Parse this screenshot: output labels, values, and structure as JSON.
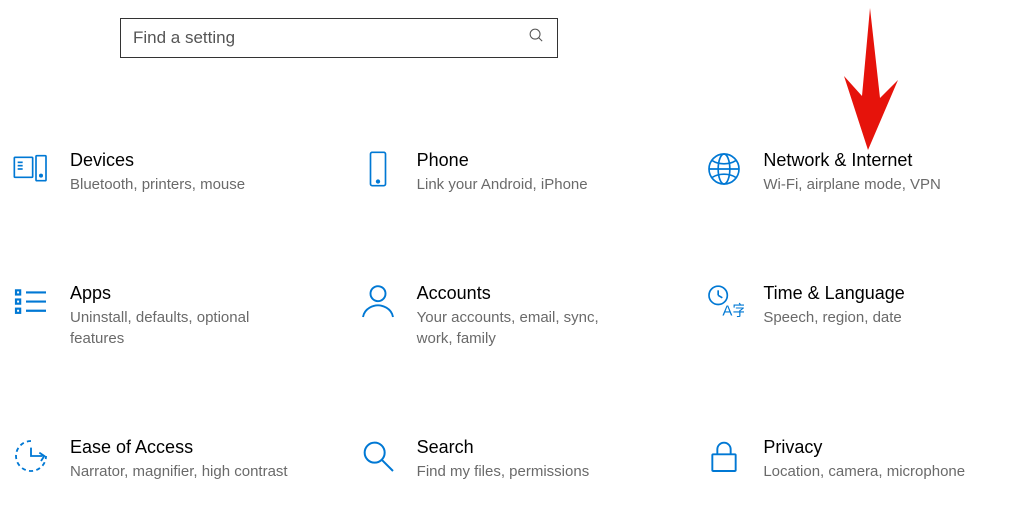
{
  "search": {
    "placeholder": "Find a setting"
  },
  "tiles": {
    "devices": {
      "title": "Devices",
      "sub": "Bluetooth, printers, mouse"
    },
    "phone": {
      "title": "Phone",
      "sub": "Link your Android, iPhone"
    },
    "network": {
      "title": "Network & Internet",
      "sub": "Wi-Fi, airplane mode, VPN"
    },
    "apps": {
      "title": "Apps",
      "sub": "Uninstall, defaults, optional features"
    },
    "accounts": {
      "title": "Accounts",
      "sub": "Your accounts, email, sync, work, family"
    },
    "time": {
      "title": "Time & Language",
      "sub": "Speech, region, date"
    },
    "ease": {
      "title": "Ease of Access",
      "sub": "Narrator, magnifier, high contrast"
    },
    "searchcat": {
      "title": "Search",
      "sub": "Find my files, permissions"
    },
    "privacy": {
      "title": "Privacy",
      "sub": "Location, camera, microphone"
    }
  }
}
